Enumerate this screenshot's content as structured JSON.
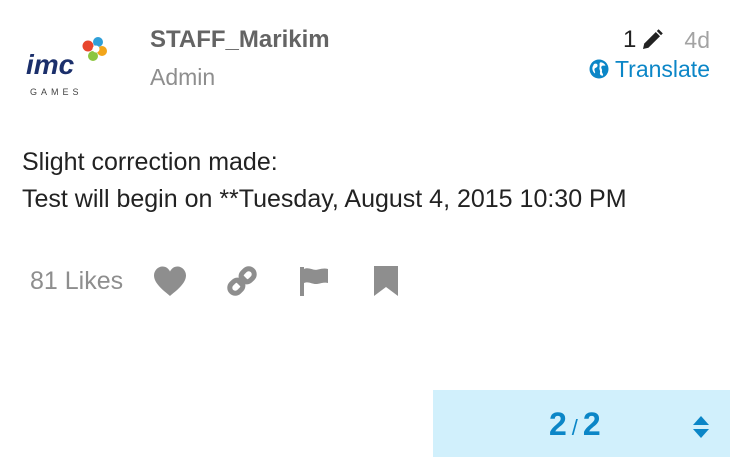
{
  "post": {
    "author": {
      "username": "STAFF_Marikim",
      "title": "Admin",
      "avatar": {
        "logo_text": "imc",
        "logo_subtext": "GAMES",
        "icon": "imc-games-logo"
      }
    },
    "edit_count": "1",
    "edit_icon": "pencil-icon",
    "age": "4d",
    "translate_label": "Translate",
    "translate_icon": "globe-icon",
    "body": [
      "Slight correction made:",
      "Test will begin on **Tuesday, August 4, 2015 10:30 PM"
    ],
    "actions": {
      "likes_label": "81 Likes",
      "like_icon": "heart-icon",
      "share_icon": "link-icon",
      "flag_icon": "flag-icon",
      "bookmark_icon": "bookmark-icon"
    }
  },
  "topic_progress": {
    "current": "2",
    "separator": "/",
    "total": "2",
    "toggle_icon": "up-down-arrows-icon"
  },
  "colors": {
    "accent": "#0b86c7",
    "muted": "#8e8e8e",
    "icon_gray": "#8e8e8e",
    "progress_bg": "#d1f0fc"
  }
}
